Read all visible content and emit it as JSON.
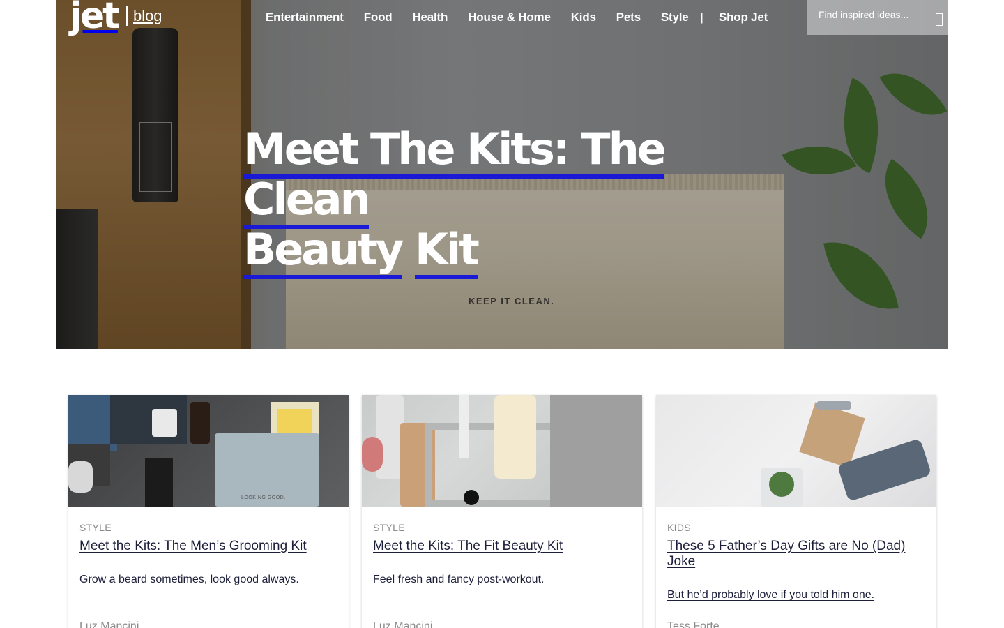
{
  "header": {
    "logo_jet": "jet",
    "logo_blog": "blog",
    "nav": [
      "Entertainment",
      "Food",
      "Health",
      "House & Home",
      "Kids",
      "Pets",
      "Style"
    ],
    "nav_separator": "|",
    "shop_label": "Shop Jet",
    "search": {
      "placeholder": "Find inspired ideas..."
    }
  },
  "hero": {
    "title_line1": "Meet The Kits: The Clean",
    "title_line2_a": "Beauty",
    "title_line2_b": "Kit",
    "pouch_text": "KEEP IT CLEAN."
  },
  "cards": [
    {
      "category": "STYLE",
      "title": "Meet the Kits: The Men’s Grooming Kit",
      "excerpt": "Grow a beard sometimes, look good always.",
      "author": "Luz Mancini",
      "pouch_text": "LOOKING GOOD."
    },
    {
      "category": "STYLE",
      "title": "Meet the Kits: The Fit Beauty Kit",
      "excerpt": "Feel fresh and fancy post-workout.",
      "author": "Luz Mancini"
    },
    {
      "category": "KIDS",
      "title": "These 5 Father’s Day Gifts are No (Dad) Joke",
      "excerpt": " But he’d probably love if you told him one.",
      "author": "Tess Forte"
    }
  ],
  "colors": {
    "link_underline": "#1a1ad6",
    "card_title": "#1d1f3a",
    "meta_gray": "#8a8a8a"
  }
}
